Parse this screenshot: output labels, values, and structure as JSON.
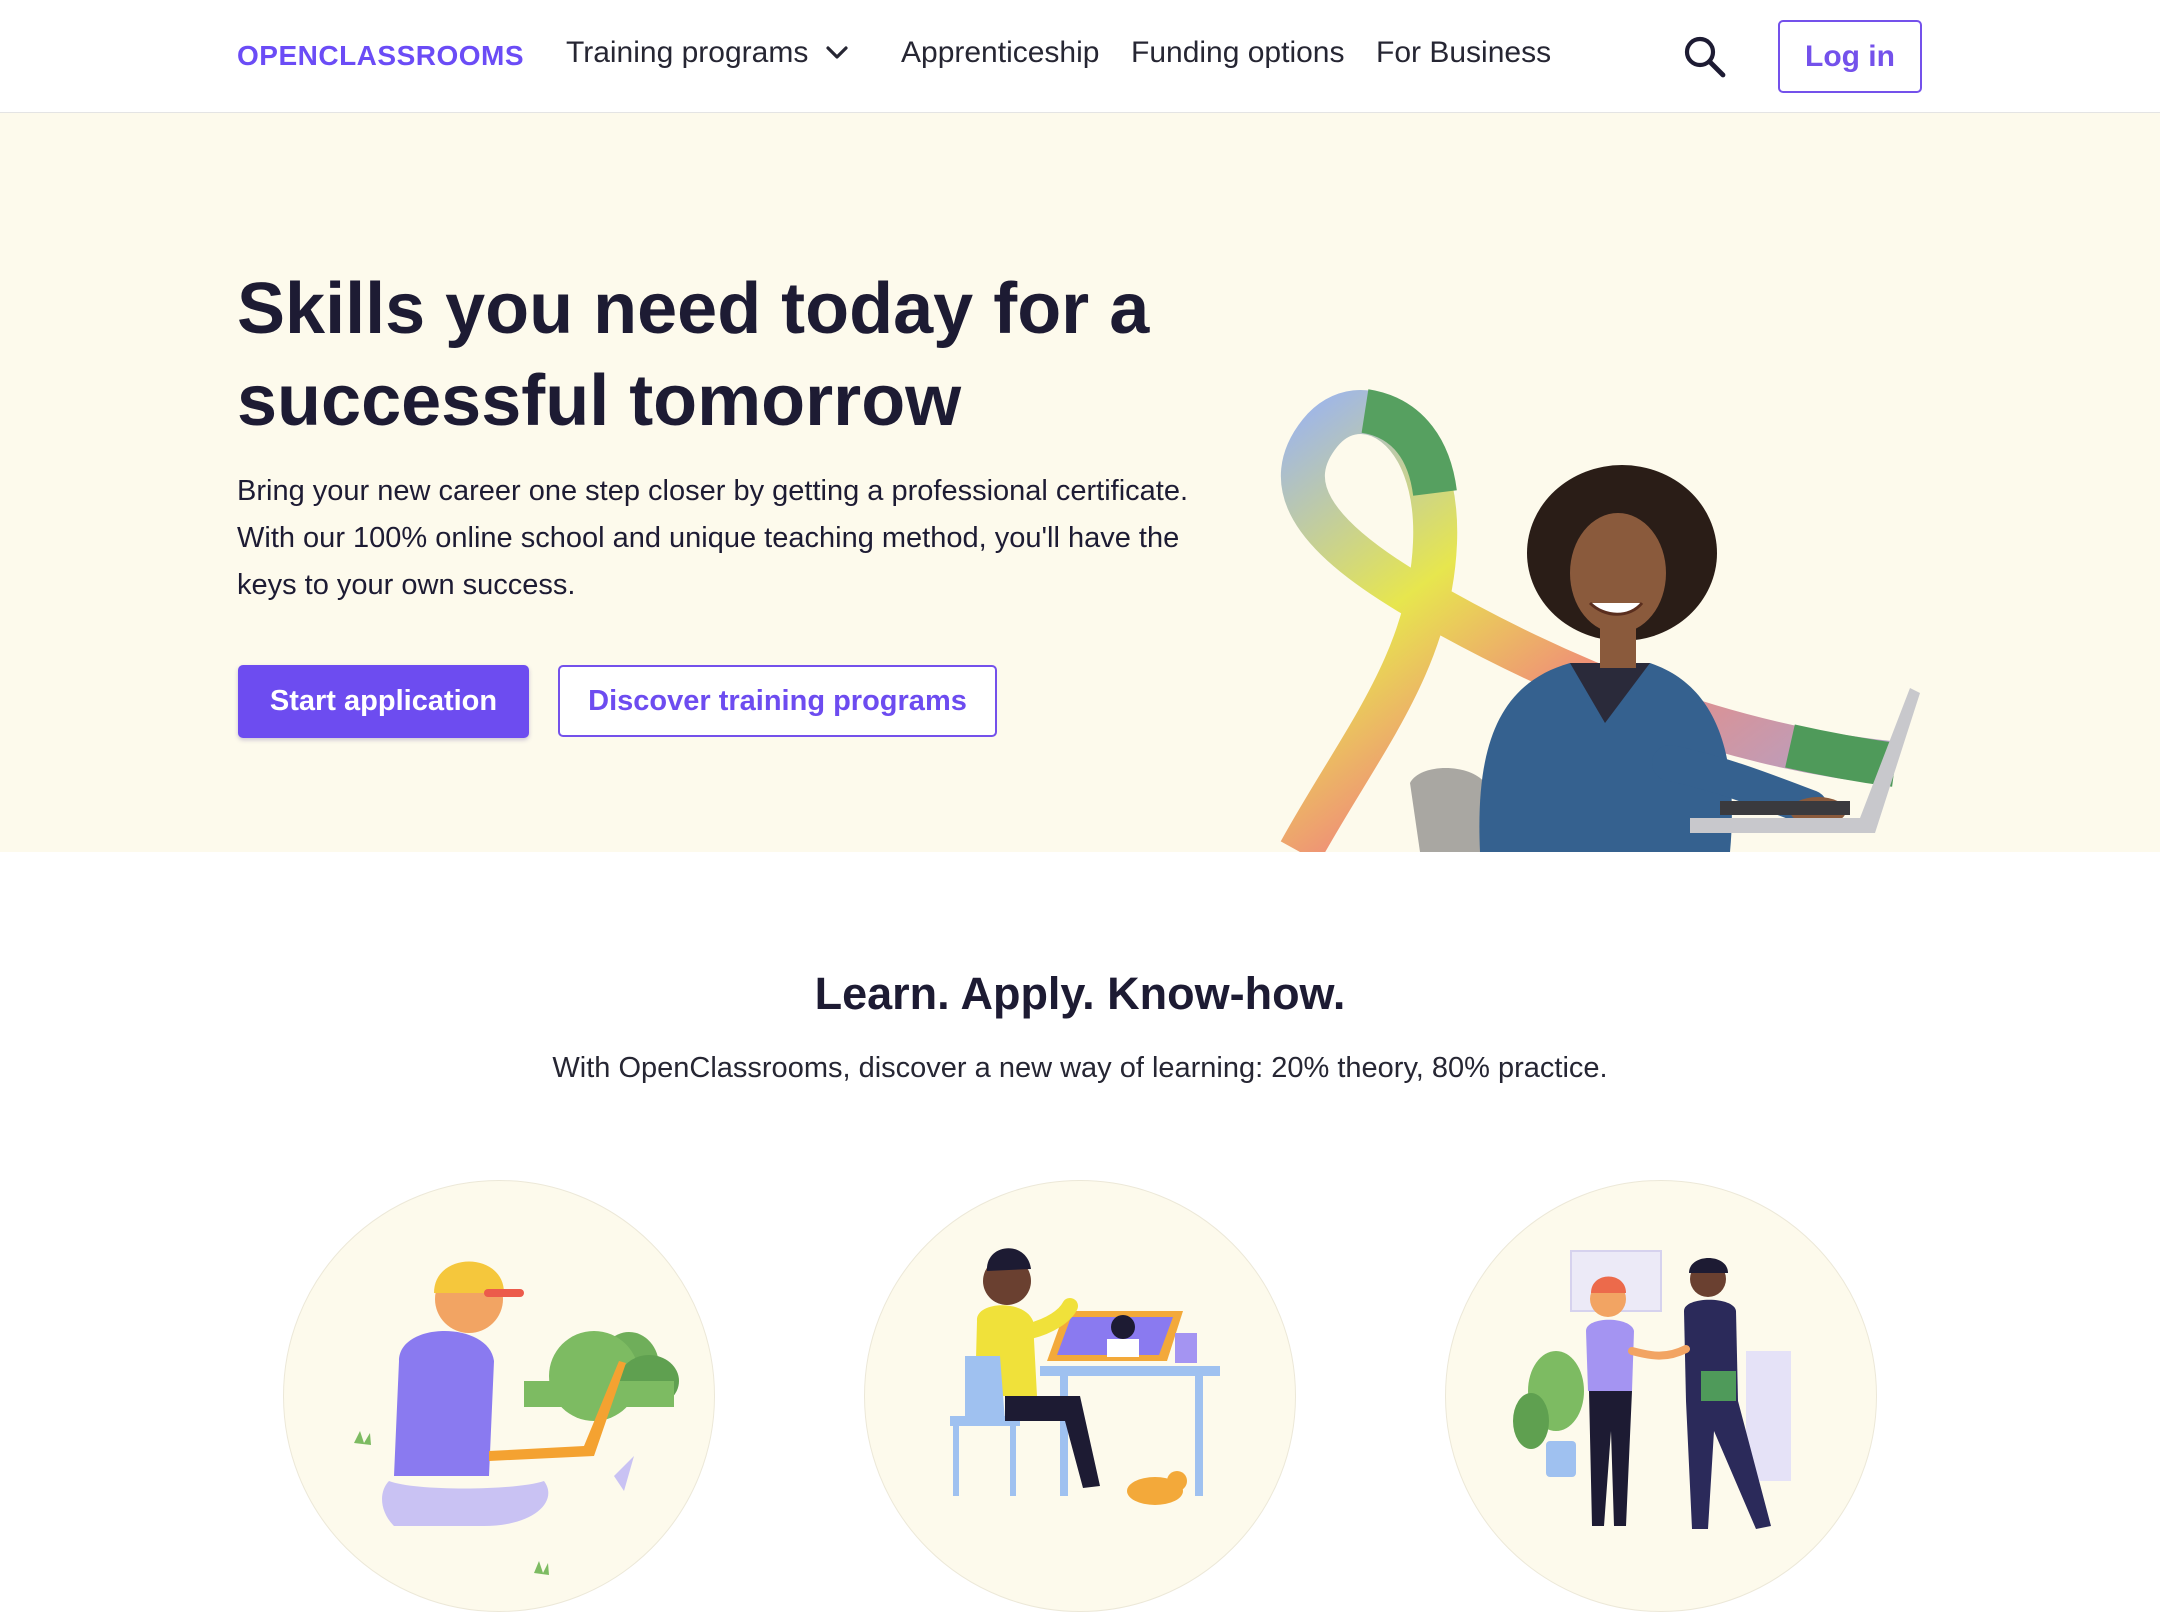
{
  "header": {
    "logo": "OPENCLASSROOMS",
    "nav": [
      {
        "label": "Training programs"
      },
      {
        "label": "Apprenticeship"
      },
      {
        "label": "Funding options"
      },
      {
        "label": "For Business"
      }
    ],
    "login_label": "Log in"
  },
  "hero": {
    "title": "Skills you need today for a successful tomorrow",
    "text": "Bring your new career one step closer by getting a professional certificate. With our 100% online school and unique teaching method, you'll have the keys to your own success.",
    "primary_cta": "Start application",
    "secondary_cta": "Discover training programs"
  },
  "learn": {
    "title": "Learn. Apply. Know-how.",
    "subtitle": "With OpenClassrooms, discover a new way of learning: 20% theory, 80% practice."
  },
  "colors": {
    "brand": "#6d4cf0",
    "hero_bg": "#fdfaec",
    "text": "#1d1b33"
  },
  "icons": {
    "dropdown": "chevron-down-icon",
    "search": "search-icon"
  }
}
